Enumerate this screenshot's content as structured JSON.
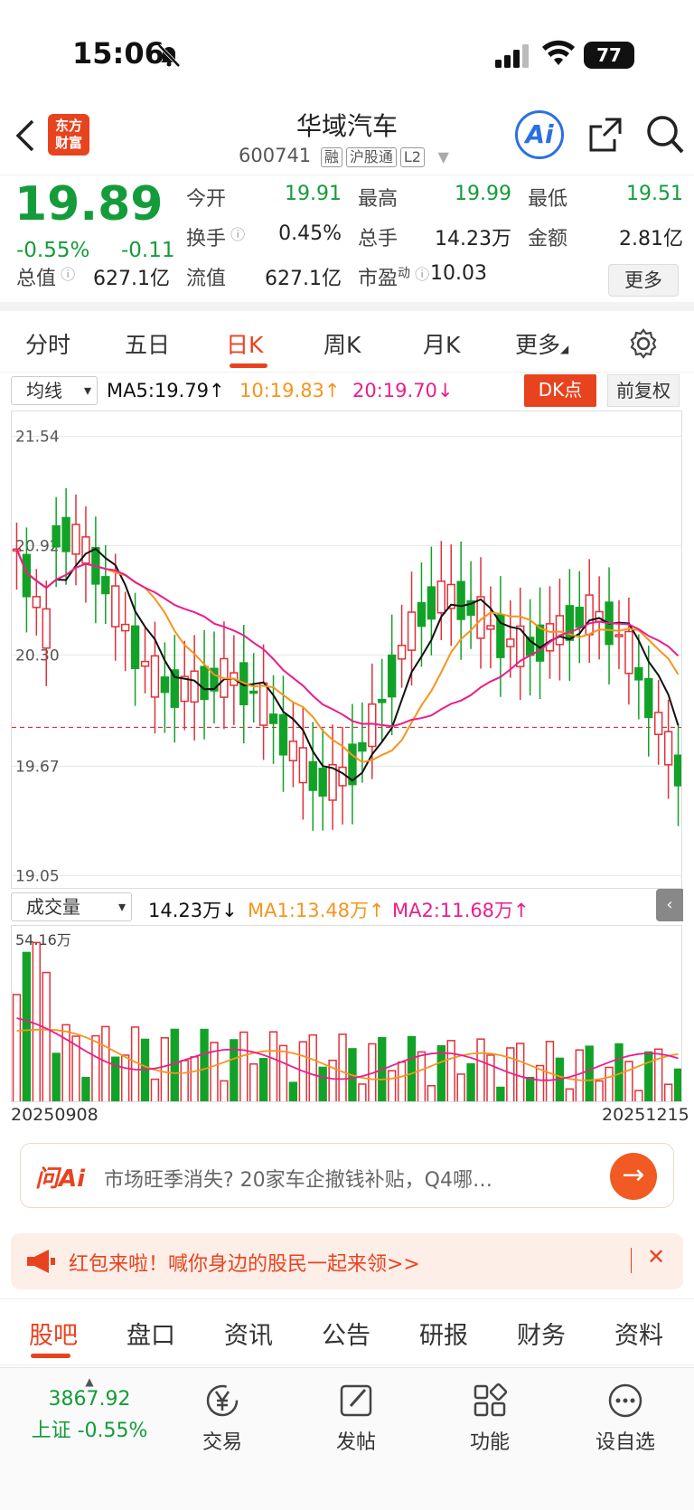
{
  "status": {
    "time": "15:06",
    "battery": "77"
  },
  "header": {
    "stock_name": "华域汽车",
    "stock_code": "600741",
    "tags": [
      "融",
      "沪股通",
      "L2"
    ],
    "logo_lines": [
      "东方",
      "财富"
    ],
    "ai_label": "Ai"
  },
  "quote": {
    "price": "19.89",
    "change_pct": "-0.55%",
    "change": "-0.11",
    "open_label": "今开",
    "open": "19.91",
    "high_label": "最高",
    "high": "19.99",
    "low_label": "最低",
    "low": "19.51",
    "turnover_label": "换手",
    "turnover": "0.45%",
    "vol_label": "总手",
    "vol": "14.23万",
    "amount_label": "金额",
    "amount": "2.81亿",
    "mcap_label": "总值",
    "mcap": "627.1亿",
    "float_label": "流值",
    "float": "627.1亿",
    "pe_label": "市盈",
    "pe_sup": "动",
    "pe": "10.03",
    "more_label": "更多"
  },
  "tabs": [
    "分时",
    "五日",
    "日K",
    "周K",
    "月K",
    "更多"
  ],
  "ma": {
    "selector": "均线",
    "ma5": "MA5:19.79↑",
    "ma10": "10:19.83↑",
    "ma20": "20:19.70↓",
    "dk": "DK点",
    "adjust": "前复权"
  },
  "volume": {
    "selector": "成交量",
    "value": "14.23万↓",
    "ma1": "MA1:13.48万↑",
    "ma2": "MA2:11.68万↑",
    "max_label": "54.16万",
    "start_date": "20250908",
    "end_date": "20251215"
  },
  "chart_data": {
    "type": "candlestick",
    "y_ticks": [
      "21.54",
      "20.92",
      "20.30",
      "19.67",
      "19.05"
    ],
    "ylim": [
      18.97,
      21.68
    ],
    "current_price": 19.89,
    "colors": {
      "up": "#e0313a",
      "down": "#12a228",
      "ma5": "#111111",
      "ma10": "#f7941d",
      "ma20": "#e91e8c"
    }
  },
  "ai_bar": {
    "label": "问Ai",
    "text": "市场旺季消失? 20家车企撤钱补贴，Q4哪…"
  },
  "promo": {
    "text": "红包来啦！喊你身边的股民一起来领>>"
  },
  "subtabs": [
    "股吧",
    "盘口",
    "资讯",
    "公告",
    "研报",
    "财务",
    "资料"
  ],
  "bottom": {
    "index_value": "3867.92",
    "index_label": "上证 -0.55%",
    "items": [
      "交易",
      "发帖",
      "功能",
      "设自选"
    ]
  }
}
